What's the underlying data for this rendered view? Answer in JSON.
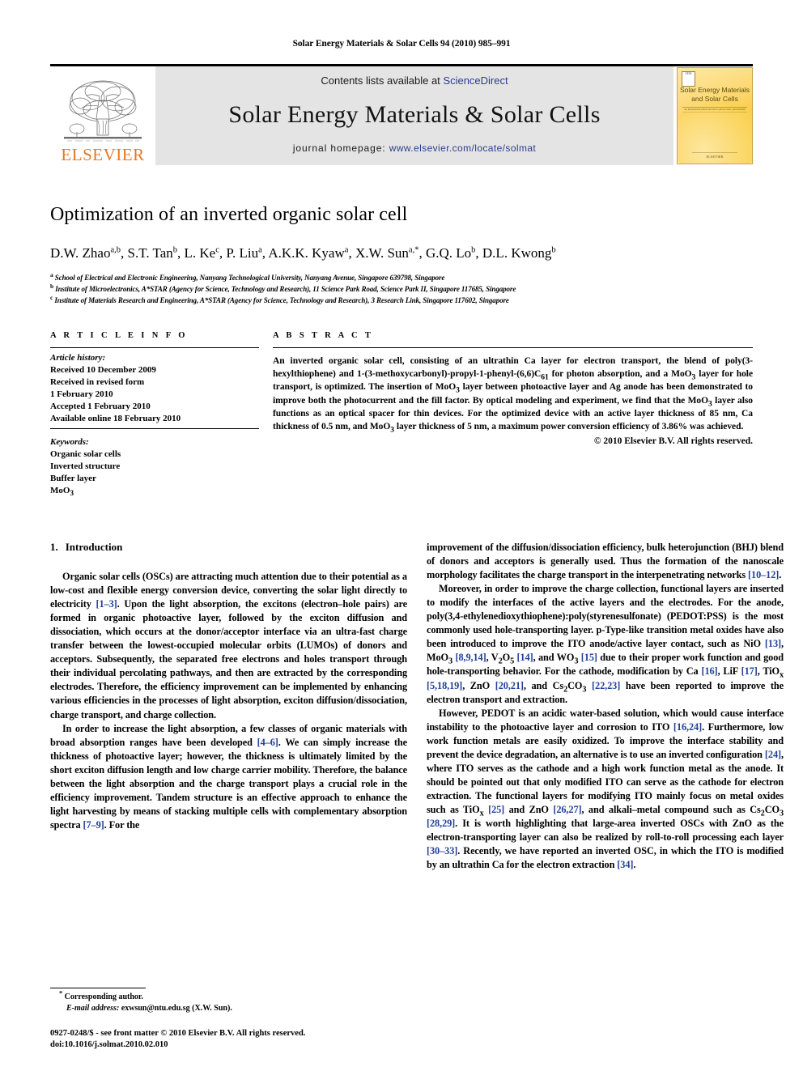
{
  "running_head": "Solar Energy Materials & Solar Cells 94 (2010) 985–991",
  "masthead": {
    "contents_prefix": "Contents lists available at ",
    "sciencedirect": "ScienceDirect",
    "journal_title": "Solar Energy Materials & Solar Cells",
    "homepage_prefix": "journal homepage: ",
    "homepage_url": "www.elsevier.com/locate/solmat",
    "publisher": "ELSEVIER",
    "cover": {
      "title_line1": "Solar Energy Materials",
      "title_line2": "and Solar Cells",
      "badge": "SEM",
      "subtitle": "An international journal devoted to photovoltaic, photothermal and photochemical solar energy conversion",
      "footer": "ELSEVIER"
    },
    "link_color": "#2d3c8c",
    "brand_color": "#E87722"
  },
  "article": {
    "title": "Optimization of an inverted organic solar cell",
    "authors": [
      {
        "name": "D.W. Zhao",
        "sup": "a,b"
      },
      {
        "name": "S.T. Tan",
        "sup": "b"
      },
      {
        "name": "L. Ke",
        "sup": "c"
      },
      {
        "name": "P. Liu",
        "sup": "a"
      },
      {
        "name": "A.K.K. Kyaw",
        "sup": "a"
      },
      {
        "name": "X.W. Sun",
        "sup": "a,*"
      },
      {
        "name": "G.Q. Lo",
        "sup": "b"
      },
      {
        "name": "D.L. Kwong",
        "sup": "b"
      }
    ],
    "affiliations": [
      {
        "mark": "a",
        "text": "School of Electrical and Electronic Engineering, Nanyang Technological University, Nanyang Avenue, Singapore 639798, Singapore"
      },
      {
        "mark": "b",
        "text": "Institute of Microelectronics, A*STAR (Agency for Science, Technology and Research), 11 Science Park Road, Science Park II, Singapore 117685, Singapore"
      },
      {
        "mark": "c",
        "text": "Institute of Materials Research and Engineering, A*STAR (Agency for Science, Technology and Research), 3 Research Link, Singapore 117602, Singapore"
      }
    ]
  },
  "article_info": {
    "heading": "A R T I C L E   I N F O",
    "history_label": "Article history:",
    "history": [
      "Received 10 December 2009",
      "Received in revised form",
      "1 February 2010",
      "Accepted 1 February 2010",
      "Available online 18 February 2010"
    ],
    "keywords_label": "Keywords:",
    "keywords": [
      "Organic solar cells",
      "Inverted structure",
      "Buffer layer",
      "MoO3"
    ]
  },
  "abstract": {
    "heading": "A B S T R A C T",
    "copyright": "© 2010 Elsevier B.V. All rights reserved."
  },
  "sections": {
    "introduction_num": "1.",
    "introduction_title": "Introduction"
  },
  "footnotes": {
    "corresponding": "Corresponding author.",
    "email_label": "E-mail address:",
    "email": "exwsun@ntu.edu.sg (X.W. Sun).",
    "imprint_line1": "0927-0248/$ - see front matter © 2010 Elsevier B.V. All rights reserved.",
    "imprint_line2": "doi:10.1016/j.solmat.2010.02.010"
  }
}
